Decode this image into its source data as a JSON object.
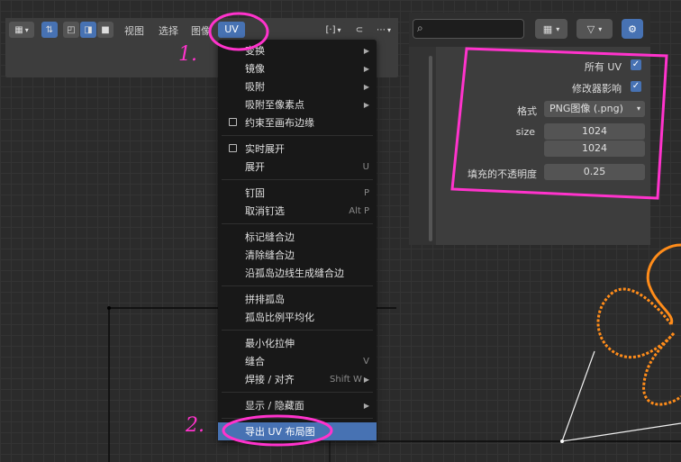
{
  "toolbar": {
    "view_label": "视图",
    "select_label": "选择",
    "image_label": "图像",
    "uv_label": "UV"
  },
  "uv_menu": {
    "items": [
      {
        "label": "变换",
        "submenu": true
      },
      {
        "label": "镜像",
        "submenu": true
      },
      {
        "label": "吸附",
        "submenu": true
      },
      {
        "label": "吸附至像素点",
        "submenu": true
      },
      {
        "label": "约束至画布边缘",
        "checkbox": true
      },
      {
        "label": "实时展开",
        "checkbox": true
      },
      {
        "label": "展开",
        "shortcut": "U"
      },
      {
        "label": "钉固",
        "shortcut": "P"
      },
      {
        "label": "取消钉选",
        "shortcut": "Alt P"
      },
      {
        "label": "标记缝合边"
      },
      {
        "label": "清除缝合边"
      },
      {
        "label": "沿孤岛边线生成缝合边"
      },
      {
        "label": "拼排孤岛"
      },
      {
        "label": "孤岛比例平均化"
      },
      {
        "label": "最小化拉伸"
      },
      {
        "label": "缝合",
        "shortcut": "V"
      },
      {
        "label": "焊接 / 对齐",
        "shortcut": "Shift W",
        "submenu": true
      },
      {
        "label": "显示 / 隐藏面",
        "submenu": true
      },
      {
        "label": "导出 UV 布局图",
        "highlighted": true
      }
    ]
  },
  "export_panel": {
    "all_uvs_label": "所有 UV",
    "all_uvs_checked": true,
    "modifier_label": "修改器影响",
    "modifier_checked": true,
    "format_label": "格式",
    "format_value": "PNG图像 (.png)",
    "size_label": "size",
    "size_x": "1024",
    "size_y": "1024",
    "fill_opacity_label": "填充的不透明度",
    "fill_opacity_value": "0.25"
  },
  "annotations": {
    "step1": "1.",
    "step2": "2."
  },
  "colors": {
    "accent": "#4772b3",
    "annotation": "#ff33cc",
    "uv_island": "#ff8c1a"
  }
}
